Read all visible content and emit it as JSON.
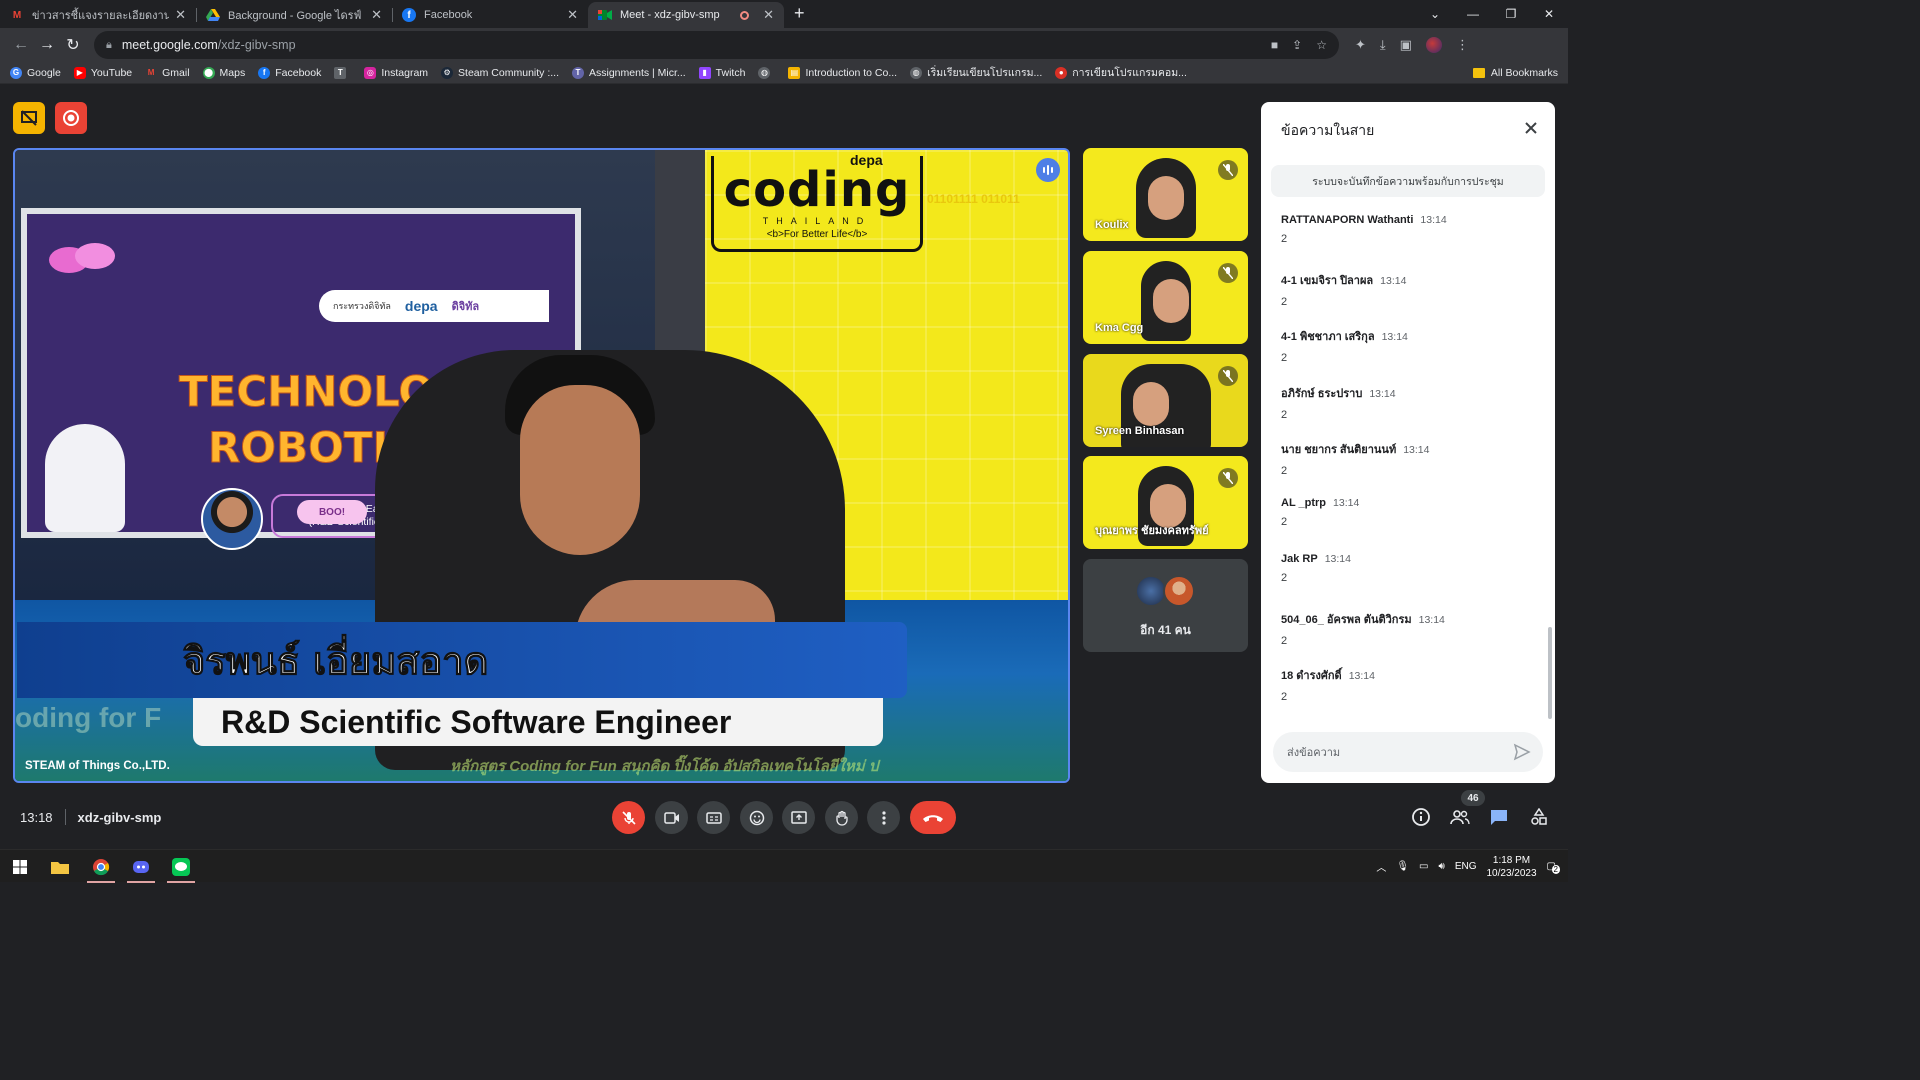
{
  "browser": {
    "tabs": [
      {
        "title": "ข่าวสารชี้แจงรายละเอียดงาน Coding",
        "icon": "gmail-icon",
        "active": false
      },
      {
        "title": "Background - Google ไดรฟ์",
        "icon": "google-drive-icon",
        "active": false
      },
      {
        "title": "Facebook",
        "icon": "facebook-icon",
        "active": false
      },
      {
        "title": "Meet - xdz-gibv-smp",
        "icon": "google-meet-icon",
        "active": true
      }
    ],
    "new_tab": "+",
    "url_host": "meet.google.com",
    "url_path": "/xdz-gibv-smp",
    "bookmarks": [
      {
        "label": "Google",
        "icon": "google-icon",
        "color": "#4285f4"
      },
      {
        "label": "YouTube",
        "icon": "youtube-icon",
        "color": "#ff0000"
      },
      {
        "label": "Gmail",
        "icon": "gmail-icon",
        "color": "#ea4335"
      },
      {
        "label": "Maps",
        "icon": "maps-icon",
        "color": "#34a853"
      },
      {
        "label": "Facebook",
        "icon": "facebook-icon",
        "color": "#1877f2"
      },
      {
        "label": "",
        "icon": "site-icon",
        "color": "#9aa0a6"
      },
      {
        "label": "Instagram",
        "icon": "instagram-icon",
        "color": "#d6249f"
      },
      {
        "label": "Steam Community :...",
        "icon": "steam-icon",
        "color": "#1b2838"
      },
      {
        "label": "Assignments | Micr...",
        "icon": "teams-icon",
        "color": "#6264a7"
      },
      {
        "label": "Twitch",
        "icon": "twitch-icon",
        "color": "#9146ff"
      },
      {
        "label": "",
        "icon": "globe-icon",
        "color": "#9aa0a6"
      },
      {
        "label": "Introduction to Co...",
        "icon": "course-icon",
        "color": "#f4b400"
      },
      {
        "label": "เริ่มเรียนเขียนโปรแกรม...",
        "icon": "globe-icon",
        "color": "#9aa0a6"
      },
      {
        "label": "การเขียนโปรแกรมคอม...",
        "icon": "record-icon",
        "color": "#d93025"
      }
    ],
    "all_bookmarks": "All Bookmarks"
  },
  "stage": {
    "presenter_label": "STEAM of Things Co.,LTD.",
    "slide_title_1": "TECHNOLOGY",
    "slide_title_2": "ROBOTICS",
    "slide_speaker_line1": "Jirapon Eamsaard",
    "slide_speaker_line2": "(R&D Scientific Software E",
    "slide_strip_org": "กระทรวงดิจิทัล",
    "slide_strip_depa": "depa",
    "slide_strip_right": "ดิจิทัล",
    "boo_candy": "BOO!",
    "logo_word": "coding",
    "logo_sub": "THAILAND",
    "logo_tag": "<b>For Better Life</b>",
    "logo_brand": "depa",
    "binary": "01101111 011011",
    "name_thai": "จิรพนธ์ เอี่ยมสอาด",
    "job_title": "R&D Scientific Software Engineer",
    "ticker_left": "oding for F",
    "ticker_bottom": "หลักสูตร Coding for Fun สนุกคิด ปิ๊งโค้ด อัปสกิลเทคโนโลยีใหม่ ป"
  },
  "participants": [
    {
      "name": "Koulix",
      "muted": true
    },
    {
      "name": "Kma Cgg",
      "muted": true
    },
    {
      "name": "Syreen Binhasan",
      "muted": true
    },
    {
      "name": "บุณยาพร ชัยมงคลทรัพย์",
      "muted": true
    }
  ],
  "more_participants": "อีก 41 คน",
  "chat": {
    "title": "ข้อความในสาย",
    "notice": "ระบบจะบันทึกข้อความพร้อมกับการประชุม",
    "messages": [
      {
        "sender": "RATTANAPORN Wathanti",
        "time": "13:14",
        "text": "2"
      },
      {
        "sender": "4-1 เขมจิรา ปิลาผล",
        "time": "13:14",
        "text": "2"
      },
      {
        "sender": "4-1 พิชชาภา เสริกุล",
        "time": "13:14",
        "text": "2"
      },
      {
        "sender": "อภิรักษ์ ธระปราบ",
        "time": "13:14",
        "text": "2"
      },
      {
        "sender": "นาย ชยากร สันติยานนท์",
        "time": "13:14",
        "text": "2"
      },
      {
        "sender": "AL _ptrp",
        "time": "13:14",
        "text": "2"
      },
      {
        "sender": "Jak RP",
        "time": "13:14",
        "text": "2"
      },
      {
        "sender": "504_06_ อัครพล ตันติวิกรม",
        "time": "13:14",
        "text": "2"
      },
      {
        "sender": "18 ดำรงศักดิ์",
        "time": "13:14",
        "text": "2"
      }
    ],
    "input_placeholder": "ส่งข้อความ"
  },
  "meeting": {
    "time": "13:18",
    "code": "xdz-gibv-smp",
    "participant_count": "46"
  },
  "taskbar": {
    "lang": "ENG",
    "clock_time": "1:18 PM",
    "clock_date": "10/23/2023",
    "notif_count": "2"
  },
  "colors": {
    "meet_bg": "#202124",
    "accent_blue": "#5a86f0",
    "hangup_red": "#ea4335",
    "chat_panel": "#ffffff",
    "slide_yellow": "#f3e81b"
  }
}
